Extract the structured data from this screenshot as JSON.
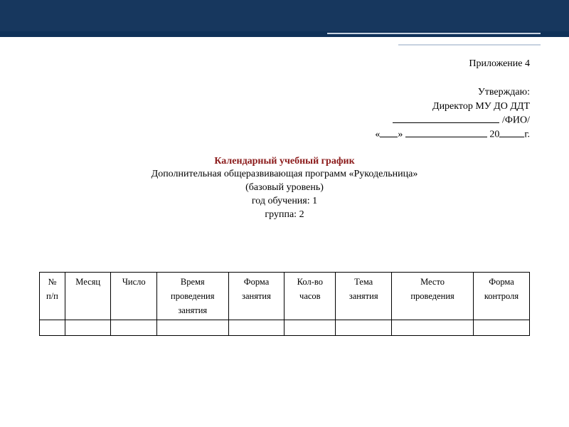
{
  "header": {
    "appendix": "Приложение 4",
    "approve": "Утверждаю:",
    "director": "Директор МУ ДО ДДТ",
    "fio_suffix": " /ФИО/",
    "date_open": "«",
    "date_mid": "»  ",
    "date_year_prefix": " 20",
    "date_year_suffix": "г."
  },
  "title": {
    "main": "Календарный учебный график",
    "program": "Дополнительная общеразвивающая программ «Рукодельница»",
    "level": "(базовый уровень)",
    "year": "год обучения: 1",
    "group": "группа: 2"
  },
  "table": {
    "headers": {
      "num_l1": "№",
      "num_l2": "п/п",
      "month": "Месяц",
      "day": "Число",
      "time_l1": "Время",
      "time_l2": "проведения",
      "time_l3": "занятия",
      "form_l1": "Форма",
      "form_l2": "занятия",
      "hours_l1": "Кол-во",
      "hours_l2": "часов",
      "topic_l1": "Тема",
      "topic_l2": "занятия",
      "place_l1": "Место",
      "place_l2": "проведения",
      "control_l1": "Форма",
      "control_l2": "контроля"
    }
  }
}
